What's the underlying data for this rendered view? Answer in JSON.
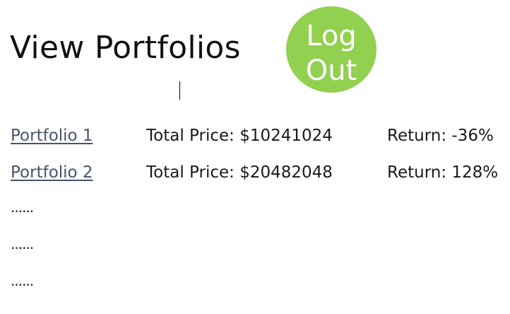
{
  "header": {
    "title": "View Portfolios"
  },
  "logout_button": {
    "line1": "Log",
    "line2": "Out",
    "color": "#92d050"
  },
  "portfolios": [
    {
      "name": "Portfolio 1",
      "total_price": "Total Price: $10241024",
      "return": "Return: -36%"
    },
    {
      "name": "Portfolio 2",
      "total_price": "Total Price: $20482048",
      "return": "Return: 128%"
    }
  ],
  "more_rows": [
    "......",
    "......",
    "......"
  ]
}
